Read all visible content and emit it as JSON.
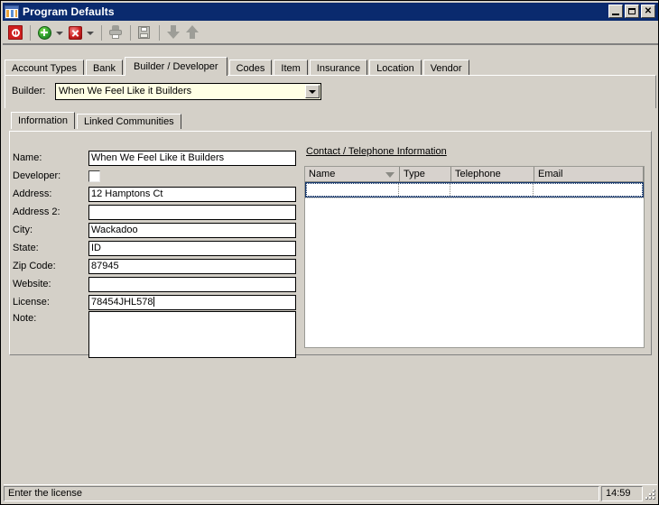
{
  "window": {
    "title": "Program Defaults",
    "icon": "program-window-icon",
    "controls": {
      "minimize": "_",
      "maximize": "▢",
      "close": "✕"
    }
  },
  "toolbar": {
    "items": [
      {
        "name": "cancel-void-button",
        "icon": "red-stop-icon",
        "enabled": true
      },
      {
        "name": "add-button",
        "icon": "green-plus-circle-icon",
        "enabled": true
      },
      {
        "name": "add-dropdown-arrow",
        "icon": "chevron-down-icon",
        "enabled": true
      },
      {
        "name": "delete-button",
        "icon": "red-x-icon",
        "enabled": true
      },
      {
        "name": "delete-dropdown-arrow",
        "icon": "chevron-down-icon",
        "enabled": true
      },
      {
        "name": "print-button",
        "icon": "printer-icon",
        "enabled": false
      },
      {
        "name": "save-button",
        "icon": "save-disk-icon",
        "enabled": false
      },
      {
        "name": "move-down-button",
        "icon": "arrow-down-icon",
        "enabled": false
      },
      {
        "name": "move-up-button",
        "icon": "arrow-up-icon",
        "enabled": false
      }
    ]
  },
  "tabs": {
    "selected": "Builder / Developer",
    "items": [
      {
        "label": "Account Types"
      },
      {
        "label": "Bank"
      },
      {
        "label": "Builder / Developer"
      },
      {
        "label": "Codes"
      },
      {
        "label": "Item"
      },
      {
        "label": "Insurance"
      },
      {
        "label": "Location"
      },
      {
        "label": "Vendor"
      }
    ]
  },
  "builder_selector": {
    "label": "Builder:",
    "value": "When We Feel Like it Builders",
    "placeholder": ""
  },
  "inner_tabs": {
    "selected": "Information",
    "items": [
      {
        "label": "Information"
      },
      {
        "label": "Linked Communities"
      }
    ]
  },
  "form": {
    "fields": [
      {
        "label": "Name:",
        "value": "When We Feel Like it Builders",
        "type": "text"
      },
      {
        "label": "Developer:",
        "value": "",
        "type": "checkbox",
        "checked": false
      },
      {
        "label": "Address:",
        "value": "12 Hamptons Ct",
        "type": "text"
      },
      {
        "label": "Address 2:",
        "value": "",
        "type": "text"
      },
      {
        "label": "City:",
        "value": "Wackadoo",
        "type": "text"
      },
      {
        "label": "State:",
        "value": "ID",
        "type": "text"
      },
      {
        "label": "Zip Code:",
        "value": "87945",
        "type": "text"
      },
      {
        "label": "Website:",
        "value": "",
        "type": "text"
      },
      {
        "label": "License:",
        "value": "78454JHL578",
        "type": "text",
        "focused": true
      },
      {
        "label": "Note:",
        "value": "",
        "type": "textarea"
      }
    ]
  },
  "contact_panel": {
    "title": "Contact / Telephone Information",
    "columns": [
      {
        "label": "Name",
        "sorted": true,
        "sort_direction": "desc"
      },
      {
        "label": "Type",
        "sorted": false
      },
      {
        "label": "Telephone",
        "sorted": false
      },
      {
        "label": "Email",
        "sorted": false
      }
    ],
    "rows": [
      {
        "name": "",
        "type": "",
        "telephone": "",
        "email": "",
        "selected": true
      }
    ]
  },
  "statusbar": {
    "message": "Enter the license",
    "time": "14:59"
  },
  "colors": {
    "titlebar": "#0a2a6e",
    "face": "#d4d0c8",
    "combo_field": "#ffffe4",
    "grid_header": "#d7d2cd",
    "selection_border": "#17386b"
  }
}
